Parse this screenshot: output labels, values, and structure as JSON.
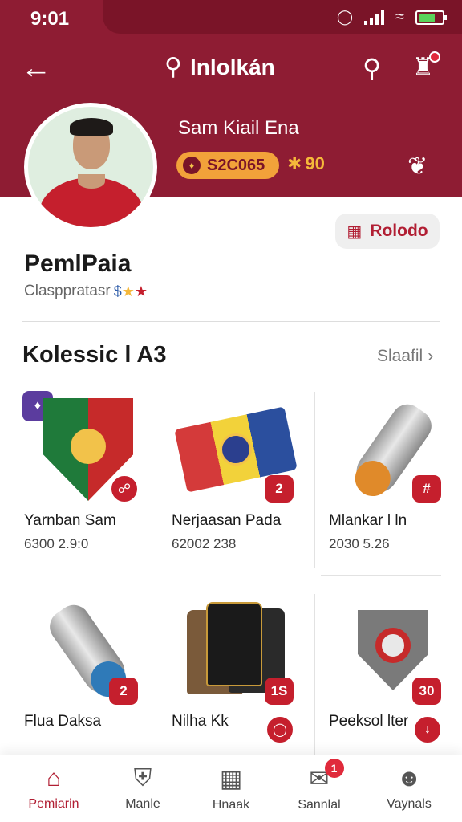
{
  "status_bar": {
    "time": "9:01",
    "battery_level": 0.7
  },
  "header": {
    "title": "lnlolkán",
    "back_icon": "arrow-left-icon",
    "search_icon": "search-icon",
    "cart_icon": "cart-icon"
  },
  "profile": {
    "name": "Sam Kiail Ena",
    "coins": "S2C065",
    "stars": "90",
    "follow_label": "Rolodo",
    "display_name": "PemlPaia",
    "subtitle": "Clasppratasr"
  },
  "collection": {
    "title": "Kolessic l A3",
    "see_all": "Slaafil",
    "items": [
      {
        "name": "Yarnban Sam",
        "price": "6300 2.9:0",
        "badge": "",
        "icon": "shield-crest"
      },
      {
        "name": "Nerjaasan Pada",
        "price": "62002 238",
        "badge": "2",
        "icon": "flag"
      },
      {
        "name": "Mlankar l ln",
        "price": "2030 5.26",
        "badge": "#",
        "icon": "tube"
      },
      {
        "name": "Flua Daksa",
        "price": "",
        "badge": "2",
        "icon": "tube-blue"
      },
      {
        "name": "Nilha Kk",
        "price": "",
        "badge": "1S",
        "icon": "jerseys"
      },
      {
        "name": "Peeksol lter",
        "price": "",
        "badge": "30",
        "icon": "shield-ring"
      }
    ]
  },
  "bottom_nav": [
    {
      "label": "Pemiarin",
      "icon": "home-icon",
      "active": true
    },
    {
      "label": "Manle",
      "icon": "shield-icon",
      "active": false
    },
    {
      "label": "Hnaak",
      "icon": "grid-icon",
      "active": false
    },
    {
      "label": "Sannlal",
      "icon": "mail-icon",
      "active": false,
      "badge": "1"
    },
    {
      "label": "Vaynals",
      "icon": "profile-icon",
      "active": false
    }
  ],
  "colors": {
    "brand": "#8e1c33",
    "accent": "#c51f2d",
    "coin_badge": "#f2a23a"
  }
}
